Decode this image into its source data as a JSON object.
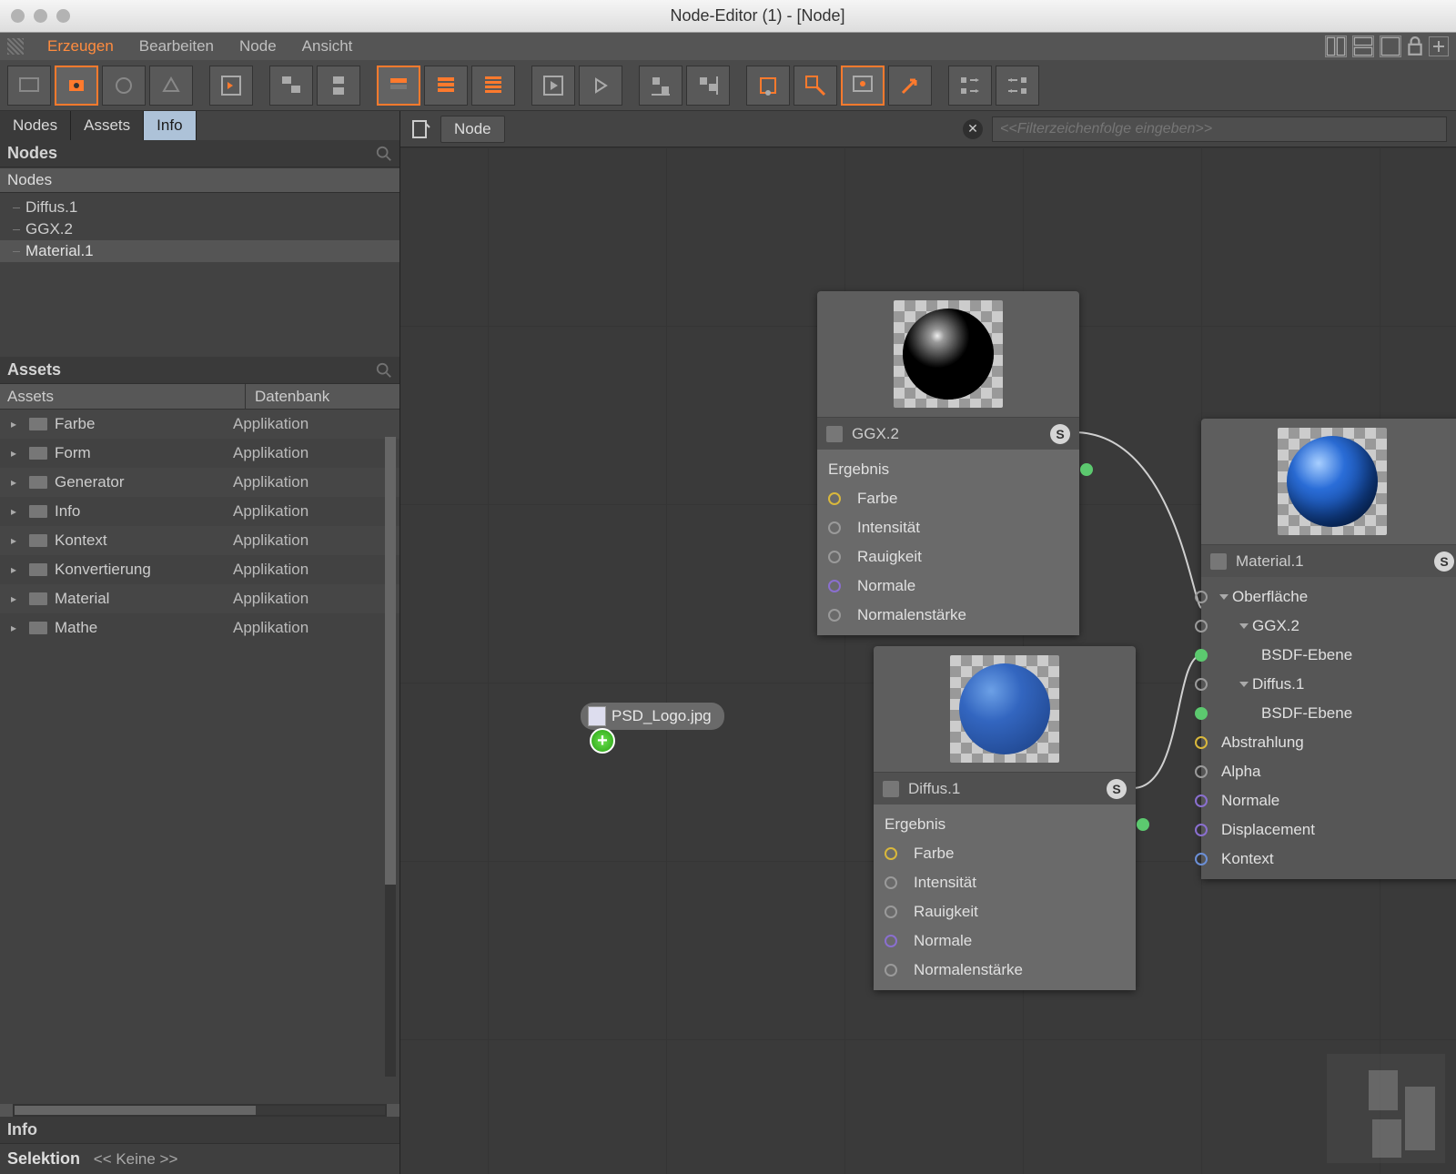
{
  "title": "Node-Editor (1) - [Node]",
  "menu": {
    "erzeugen": "Erzeugen",
    "bearbeiten": "Bearbeiten",
    "node": "Node",
    "ansicht": "Ansicht"
  },
  "tabs": {
    "nodes": "Nodes",
    "assets": "Assets",
    "info": "Info"
  },
  "nodes_section": "Nodes",
  "nodes_col": "Nodes",
  "nodes_tree": [
    "Diffus.1",
    "GGX.2",
    "Material.1"
  ],
  "assets_section": "Assets",
  "assets_cols": {
    "name": "Assets",
    "db": "Datenbank"
  },
  "assets": [
    {
      "name": "Farbe",
      "db": "Applikation"
    },
    {
      "name": "Form",
      "db": "Applikation"
    },
    {
      "name": "Generator",
      "db": "Applikation"
    },
    {
      "name": "Info",
      "db": "Applikation"
    },
    {
      "name": "Kontext",
      "db": "Applikation"
    },
    {
      "name": "Konvertierung",
      "db": "Applikation"
    },
    {
      "name": "Material",
      "db": "Applikation"
    },
    {
      "name": "Mathe",
      "db": "Applikation"
    }
  ],
  "info_section": "Info",
  "info": {
    "sel_label": "Selektion",
    "sel_value": "<< Keine >>"
  },
  "breadcrumb": "Node",
  "filter_placeholder": "<<Filterzeichenfolge eingeben>>",
  "drag_file": "PSD_Logo.jpg",
  "node_ggx": {
    "title": "GGX.2",
    "badge": "S",
    "out": "Ergebnis",
    "ports": [
      "Farbe",
      "Intensität",
      "Rauigkeit",
      "Normale",
      "Normalenstärke"
    ]
  },
  "node_diffus": {
    "title": "Diffus.1",
    "badge": "S",
    "out": "Ergebnis",
    "ports": [
      "Farbe",
      "Intensität",
      "Rauigkeit",
      "Normale",
      "Normalenstärke"
    ]
  },
  "node_material": {
    "title": "Material.1",
    "badge": "S",
    "rows": [
      {
        "conn": "grey",
        "txt": "Oberfläche",
        "disclose": true,
        "lvl": 0
      },
      {
        "conn": "grey",
        "txt": "GGX.2",
        "disclose": true,
        "lvl": 1
      },
      {
        "conn": "green",
        "txt": "BSDF-Ebene",
        "lvl": 2
      },
      {
        "conn": "grey",
        "txt": "Diffus.1",
        "disclose": true,
        "lvl": 1
      },
      {
        "conn": "green",
        "txt": "BSDF-Ebene",
        "lvl": 2
      },
      {
        "conn": "yellow",
        "txt": "Abstrahlung",
        "lvl": 0
      },
      {
        "conn": "grey",
        "txt": "Alpha",
        "lvl": 0
      },
      {
        "conn": "purple",
        "txt": "Normale",
        "lvl": 0
      },
      {
        "conn": "purple",
        "txt": "Displacement",
        "lvl": 0
      },
      {
        "conn": "blue",
        "txt": "Kontext",
        "lvl": 0
      }
    ]
  }
}
